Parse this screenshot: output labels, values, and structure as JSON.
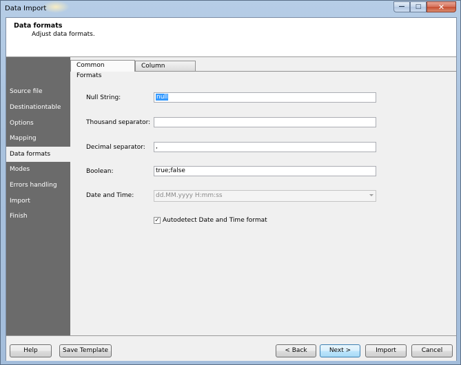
{
  "window": {
    "title": "Data Import"
  },
  "header": {
    "title": "Data formats",
    "subtitle": "Adjust data formats."
  },
  "sidebar": {
    "items": [
      {
        "label": "Source file"
      },
      {
        "label": "Destinationtable"
      },
      {
        "label": "Options"
      },
      {
        "label": "Mapping"
      },
      {
        "label": "Data formats",
        "active": true
      },
      {
        "label": "Modes"
      },
      {
        "label": "Errors handling"
      },
      {
        "label": "Import"
      },
      {
        "label": "Finish"
      }
    ]
  },
  "tabs": [
    {
      "label": "Common Formats",
      "selected": true
    },
    {
      "label": "Column Settings",
      "selected": false
    }
  ],
  "form": {
    "null_string_label": "Null String:",
    "null_string_value": "null",
    "thousand_label": "Thousand separator:",
    "thousand_value": "",
    "decimal_label": "Decimal separator:",
    "decimal_value": ",",
    "boolean_label": "Boolean:",
    "boolean_value": "true;false",
    "datetime_label": "Date and Time:",
    "datetime_value": "dd.MM.yyyy H:mm:ss",
    "autodetect_label": "Autodetect Date and Time format",
    "autodetect_checked": true
  },
  "footer": {
    "help": "Help",
    "save_template": "Save Template",
    "back": "< Back",
    "next": "Next >",
    "import": "Import",
    "cancel": "Cancel"
  }
}
